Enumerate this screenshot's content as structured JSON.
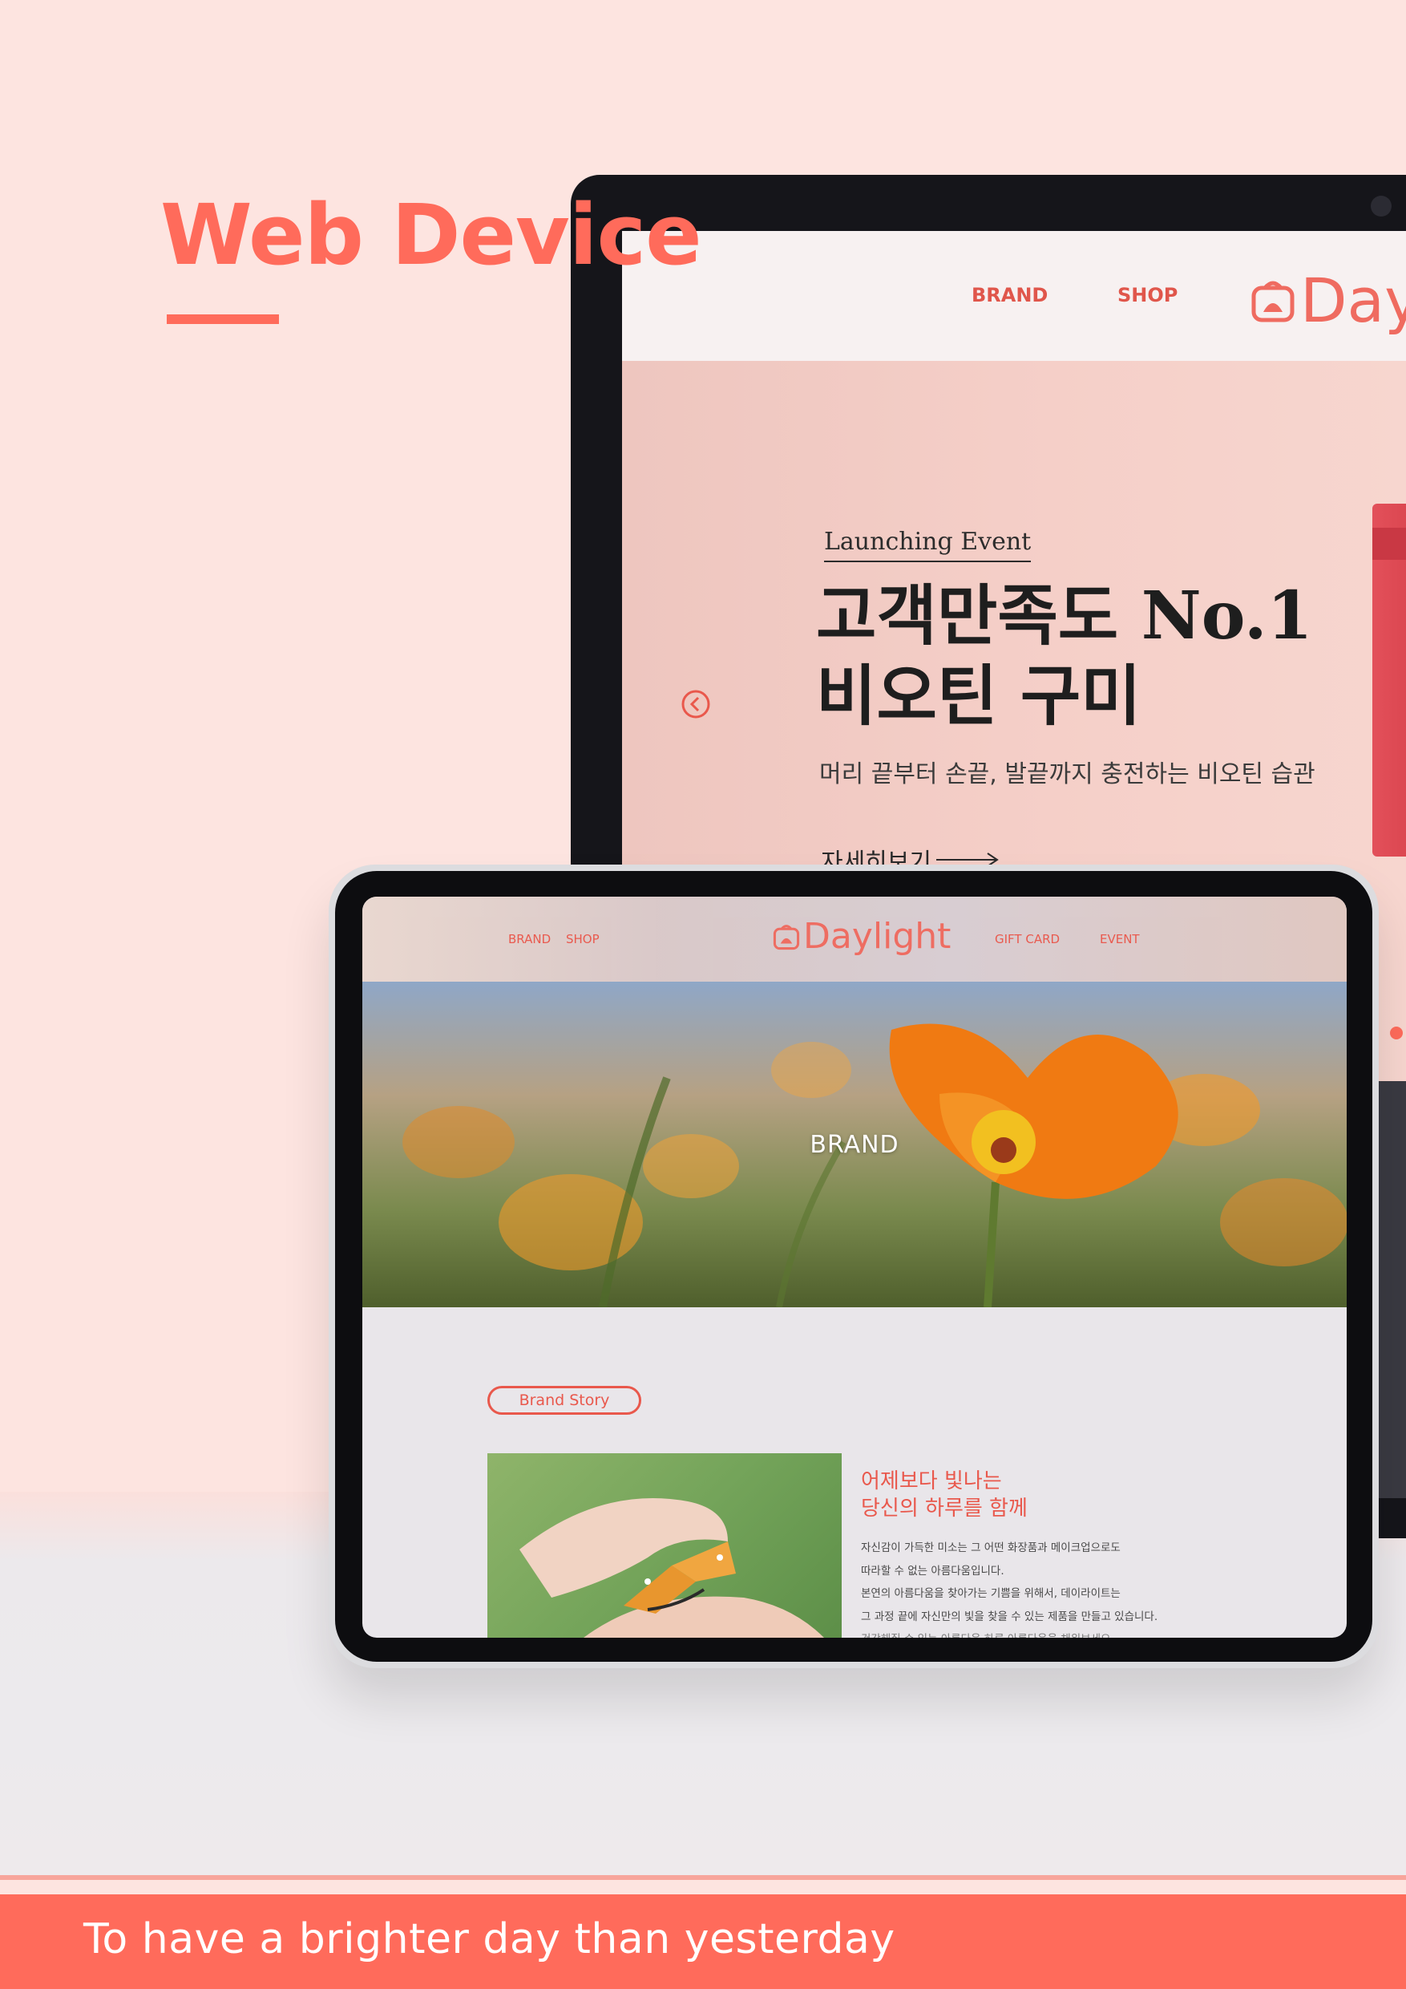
{
  "page": {
    "title": "Web Device",
    "tagline": "To have a brighter day than yesterday"
  },
  "colors": {
    "accent": "#ff6b5b",
    "background": "#fde4e0"
  },
  "monitor": {
    "nav": {
      "links": [
        "BRAND",
        "SHOP"
      ],
      "logo": "Dayl"
    },
    "hero": {
      "event_label": "Launching Event",
      "headline_line1": "고객만족도 No.1",
      "headline_line2": "비오틴 구미",
      "subtext": "머리 끝부터 손끝, 발끝까지 충전하는 비오틴 습관",
      "more_label": "자세히보기"
    },
    "icons": [
      "chevron-left-circle-icon",
      "arrow-right-icon",
      "logo-bag-icon"
    ]
  },
  "tablet": {
    "nav": {
      "links_left": [
        "BRAND",
        "SHOP"
      ],
      "logo": "Daylight",
      "links_right": [
        "GIFT CARD",
        "EVENT"
      ]
    },
    "hero_label": "BRAND",
    "story": {
      "badge": "Brand Story",
      "title_line1": "어제보다 빛나는",
      "title_line2": "당신의 하루를 함께",
      "body": [
        "자신감이 가득한 미소는 그 어떤 화장품과 메이크업으로도",
        "따라할 수 없는 아름다움입니다.",
        "본연의 아름다움을 찾아가는 기쁨을 위해서, 데이라이트는",
        "그 과정 끝에 자신만의 빛을 찾을 수 있는 제품을 만들고 있습니다.",
        "건강해질 수 있는 아름다움 하루 아름다움을 채워보세요."
      ]
    }
  }
}
